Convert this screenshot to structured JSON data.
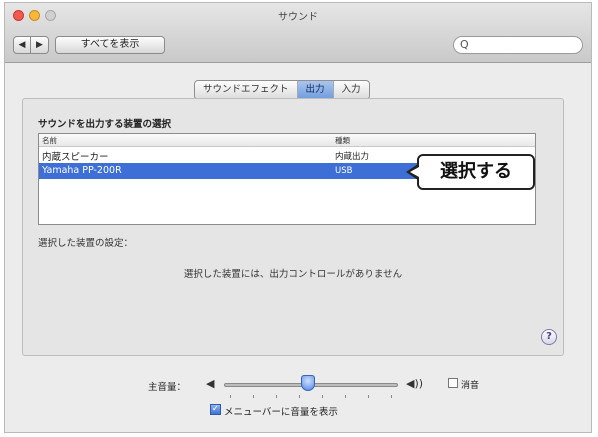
{
  "window": {
    "title": "サウンド"
  },
  "toolbar": {
    "back_symbol": "◀",
    "forward_symbol": "▶",
    "show_all_label": "すべてを表示",
    "search_symbol": "Q",
    "search_value": ""
  },
  "tabs": [
    {
      "label": "サウンドエフェクト",
      "active": false
    },
    {
      "label": "出力",
      "active": true
    },
    {
      "label": "入力",
      "active": false
    }
  ],
  "output": {
    "section_title": "サウンドを出力する装置の選択",
    "columns": [
      "名前",
      "種類"
    ],
    "devices": [
      {
        "name": "内蔵スピーカー",
        "type": "内蔵出力",
        "selected": false
      },
      {
        "name": "Yamaha PP-200R",
        "type": "USB",
        "selected": true
      }
    ],
    "settings_label": "選択した装置の設定：",
    "no_controls_text": "選択した装置には、出力コントロールがありません",
    "help_symbol": "?"
  },
  "annotation": {
    "callout_text": "選択する"
  },
  "volume": {
    "label": "主音量：",
    "low_icon": "◀",
    "high_icon": "◀))",
    "level_fraction": 0.48,
    "mute_label": "消音",
    "mute_checked": false
  },
  "menubar": {
    "show_volume_label": "メニューバーに音量を表示",
    "checked": true,
    "check_symbol": "✓"
  },
  "colors": {
    "selection": "#3d6fd6",
    "accent": "#4f86e3"
  }
}
